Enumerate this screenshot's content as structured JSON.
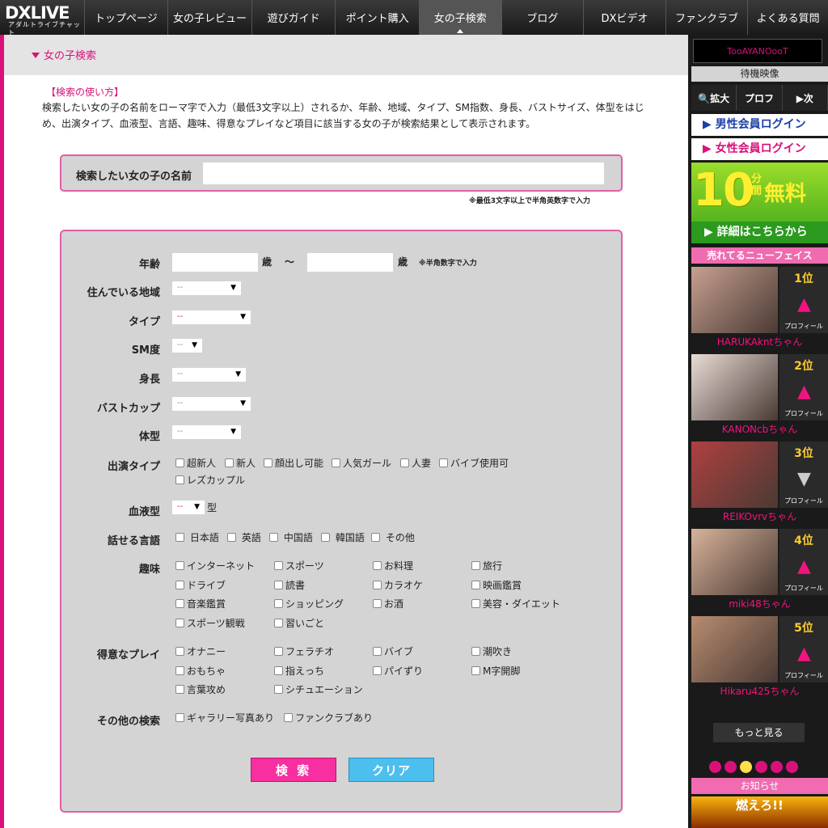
{
  "nav": {
    "logo_main": "DXLIVE",
    "logo_sub": "アダルトライブチャット",
    "items": [
      "トップページ",
      "女の子レビュー",
      "遊びガイド",
      "ポイント購入",
      "女の子検索",
      "ブログ",
      "DXビデオ",
      "ファンクラブ",
      "よくある質問"
    ]
  },
  "header": {
    "title": "女の子検索"
  },
  "howto": {
    "heading": "【検索の使い方】",
    "text": "検索したい女の子の名前をローマ字で入力（最低3文字以上）されるか、年齢、地域、タイプ、SM指数、身長、バストサイズ、体型をはじめ、出演タイプ、血液型、言語、趣味、得意なプレイなど項目に該当する女の子が検索結果として表示されます。"
  },
  "name_search": {
    "label": "検索したい女の子の名前",
    "note": "※最低3文字以上で半角英数字で入力"
  },
  "form": {
    "age_label": "年齢",
    "age_unit": "歳",
    "age_sep": "〜",
    "age_note": "※半角数字で入力",
    "region_label": "住んでいる地域",
    "type_label": "タイプ",
    "sm_label": "SM度",
    "height_label": "身長",
    "bust_label": "バストカップ",
    "body_label": "体型",
    "select_default": "--",
    "appearance_label": "出演タイプ",
    "appearance": [
      "超新人",
      "新人",
      "顔出し可能",
      "人気ガール",
      "人妻",
      "バイブ使用可",
      "レズカップル"
    ],
    "blood_label": "血液型",
    "blood_unit": "型",
    "lang_label": "話せる言語",
    "languages": [
      "日本語",
      "英語",
      "中国語",
      "韓国語",
      "その他"
    ],
    "hobby_label": "趣味",
    "hobbies": [
      "インターネット",
      "スポーツ",
      "お料理",
      "旅行",
      "ドライブ",
      "読書",
      "カラオケ",
      "映画鑑賞",
      "音楽鑑賞",
      "ショッピング",
      "お酒",
      "美容・ダイエット",
      "スポーツ観戦",
      "習いごと"
    ],
    "play_label": "得意なプレイ",
    "plays": [
      "オナニー",
      "フェラチオ",
      "バイブ",
      "潮吹き",
      "おもちゃ",
      "指えっち",
      "パイずり",
      "M字開脚",
      "言葉攻め",
      "シチュエーション"
    ],
    "other_label": "その他の検索",
    "others": [
      "ギャラリー写真あり",
      "ファンクラブあり"
    ],
    "search_button": "検 索",
    "clear_button": "クリア"
  },
  "sidebar": {
    "user": "TooAYANOooT",
    "wait_video": "待機映像",
    "tools": [
      "🔍拡大",
      "プロフ",
      "▶次"
    ],
    "male_login": "▶ 男性会員ログイン",
    "female_login": "▶ 女性会員ログイン",
    "promo_big": "10",
    "promo_unit": "分間",
    "promo_free": "無料",
    "promo_more": "▶ 詳細はこちらから",
    "new_face": "売れてるニューフェイス",
    "profile_label": "プロフィール",
    "ranks": [
      {
        "rank": "1位",
        "name": "HARUKAkntちゃん",
        "trend": "up"
      },
      {
        "rank": "2位",
        "name": "KANONcbちゃん",
        "trend": "up"
      },
      {
        "rank": "3位",
        "name": "REIKOvrvちゃん",
        "trend": "down"
      },
      {
        "rank": "4位",
        "name": "miki48ちゃん",
        "trend": "up"
      },
      {
        "rank": "5位",
        "name": "Hikaru425ちゃん",
        "trend": "up"
      }
    ],
    "more": "もっと見る",
    "news": "お知らせ",
    "banner": "燃えろ!!"
  },
  "colors": {
    "accent": "#d8117a",
    "search_btn": "#f72fa0",
    "clear_btn": "#4cbfee"
  }
}
